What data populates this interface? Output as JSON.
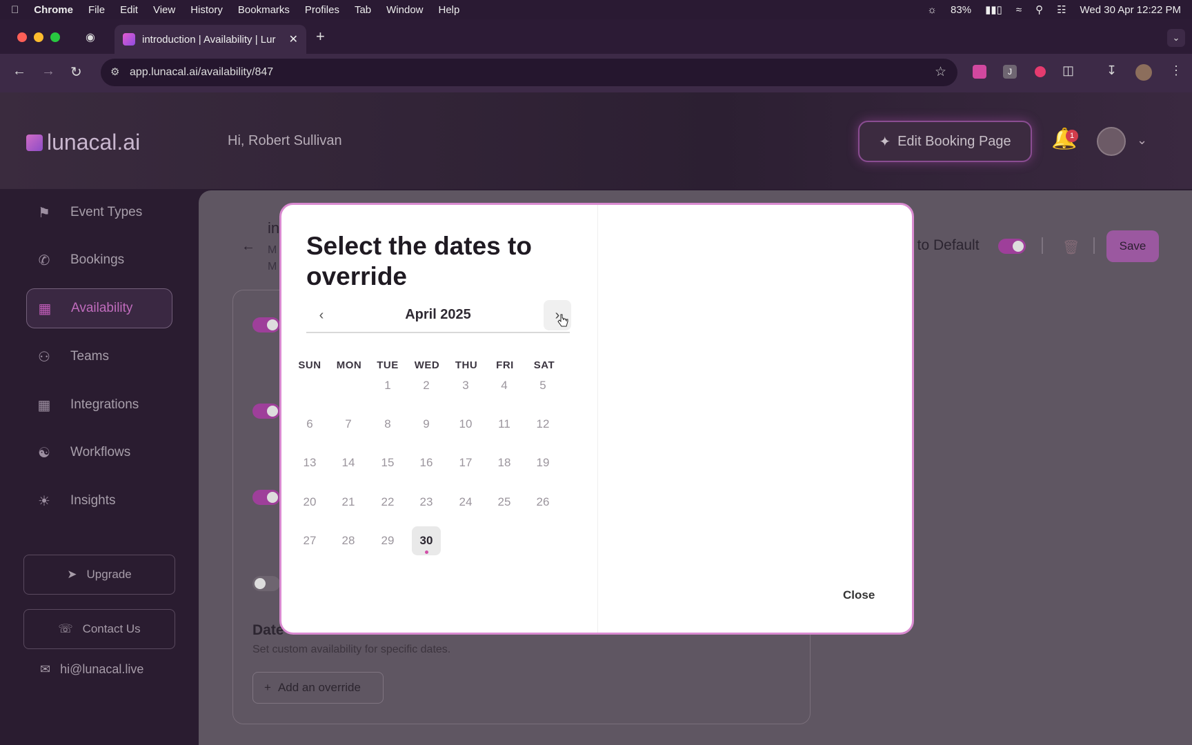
{
  "menubar": {
    "app": "Chrome",
    "items": [
      "File",
      "Edit",
      "View",
      "History",
      "Bookmarks",
      "Profiles",
      "Tab",
      "Window",
      "Help"
    ],
    "battery": "83%",
    "datetime": "Wed 30 Apr  12:22 PM"
  },
  "browser": {
    "tab_title": "introduction | Availability | Lur",
    "url": "app.lunacal.ai/availability/847"
  },
  "header": {
    "logo_text": "lunacal.ai",
    "greeting": "Hi, Robert Sullivan",
    "edit_booking_label": "Edit Booking Page",
    "notification_count": "1"
  },
  "sidebar": {
    "items": [
      {
        "label": "Event Types",
        "icon": "flag-icon"
      },
      {
        "label": "Bookings",
        "icon": "phone-icon"
      },
      {
        "label": "Availability",
        "icon": "calendar-clock-icon"
      },
      {
        "label": "Teams",
        "icon": "users-icon"
      },
      {
        "label": "Integrations",
        "icon": "grid-icon"
      },
      {
        "label": "Workflows",
        "icon": "workflow-icon"
      },
      {
        "label": "Insights",
        "icon": "bulb-icon"
      }
    ],
    "upgrade_label": "Upgrade",
    "contact_label": "Contact Us",
    "email": "hi@lunacal.live"
  },
  "main": {
    "schedule_name": "in",
    "meta_line1": "M",
    "meta_line2": "M",
    "reset_label": "t to Default",
    "save_label": "Save",
    "dates_title": "Date",
    "dates_subtitle": "Set custom availability for specific dates.",
    "add_override_label": "Add an override"
  },
  "modal": {
    "title": "Select the dates to override",
    "month_label": "April 2025",
    "weekdays": [
      "SUN",
      "MON",
      "TUE",
      "WED",
      "THU",
      "FRI",
      "SAT"
    ],
    "selected_day": "30",
    "close_label": "Close"
  },
  "colors": {
    "accent": "#c06cbd",
    "modal_border": "#d98ad0",
    "toggle_on": "#9e3f9a"
  }
}
